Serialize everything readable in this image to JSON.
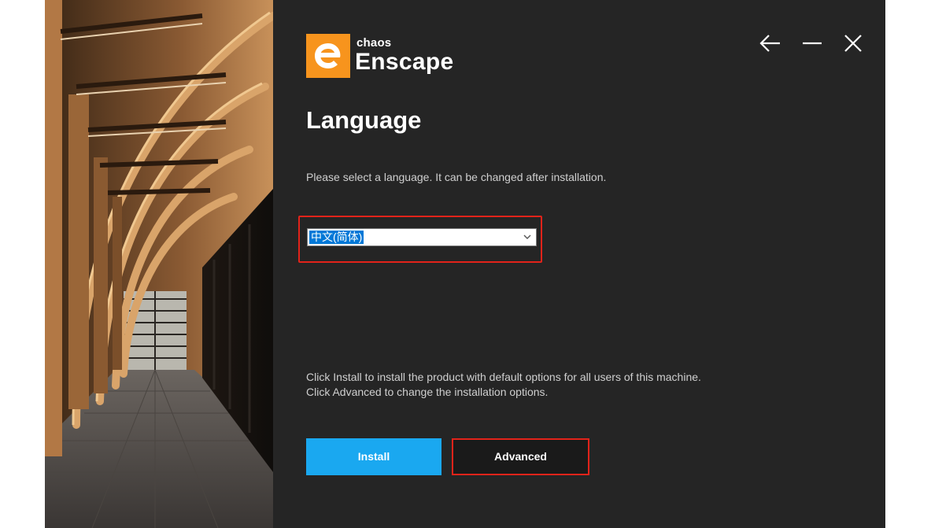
{
  "brand": {
    "company": "chaos",
    "product": "Enscape",
    "logo_icon": "enscape-e-logo",
    "accent_color": "#f7941d"
  },
  "window_controls": {
    "back_icon": "arrow-left-icon",
    "minimize_icon": "minimize-icon",
    "close_icon": "close-icon"
  },
  "page": {
    "title": "Language",
    "subtitle": "Please select a language. It can be changed after installation."
  },
  "language_select": {
    "selected": "中文(简体)",
    "chevron_icon": "chevron-down-icon",
    "highlight_color": "#e2231a"
  },
  "info": {
    "line1": "Click Install to install the product with default options for all users of this machine.",
    "line2": "Click Advanced to change the installation options."
  },
  "buttons": {
    "install": "Install",
    "advanced": "Advanced",
    "install_color": "#1aa8f0"
  }
}
